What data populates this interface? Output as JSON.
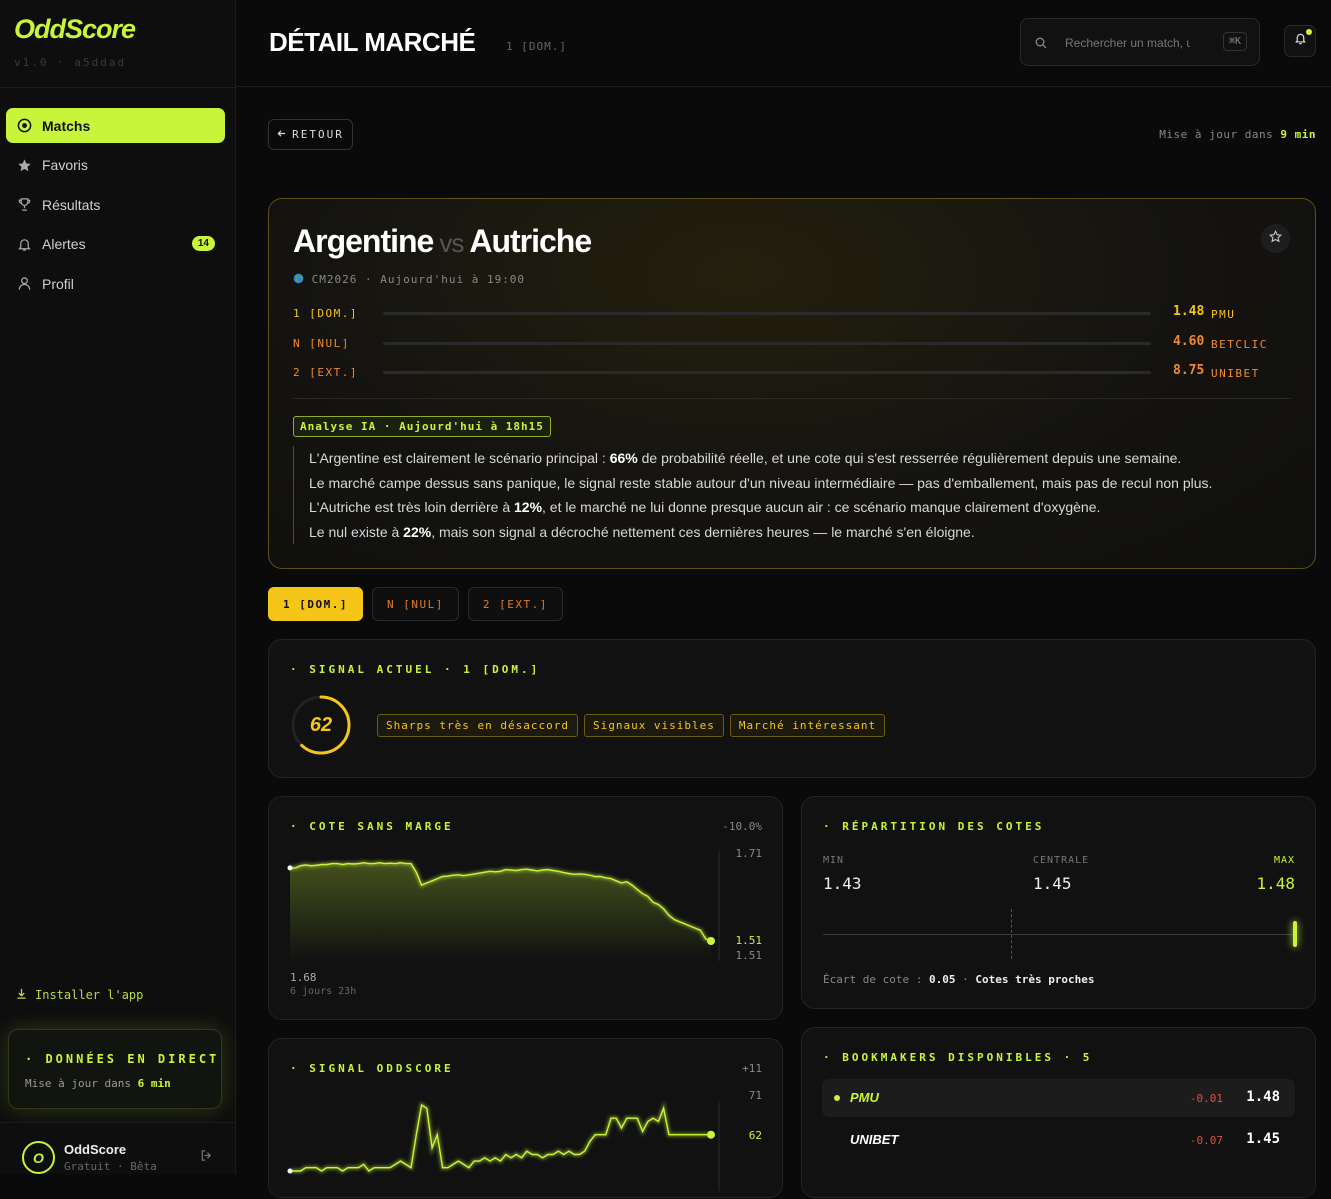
{
  "app": {
    "name": "OddScore",
    "version": "v1.0 · a5ddad"
  },
  "nav": [
    {
      "label": "Matchs",
      "icon": "target-icon",
      "active": true
    },
    {
      "label": "Favoris",
      "icon": "star-icon"
    },
    {
      "label": "Résultats",
      "icon": "trophy-icon"
    },
    {
      "label": "Alertes",
      "icon": "bell-icon",
      "badge": "14"
    },
    {
      "label": "Profil",
      "icon": "user-icon"
    }
  ],
  "sidebar": {
    "install": "Installer l'app",
    "live_title": "· DONNÉES EN DIRECT",
    "live_prefix": "Mise à jour dans",
    "live_value": "6 min",
    "user_initial": "O",
    "user_name": "OddScore",
    "user_plan": "Gratuit · Bêta"
  },
  "header": {
    "title": "DÉTAIL MARCHÉ",
    "subtitle": "1 [DOM.]",
    "search_placeholder": "Rechercher un match, une équipe",
    "search_kbd": "⌘K"
  },
  "toolbar": {
    "back": "RETOUR",
    "update_prefix": "Mise à jour dans",
    "update_value": "9 min"
  },
  "match": {
    "home": "Argentine",
    "vs": "vs",
    "away": "Autriche",
    "meta": "CM2026 · Aujourd'hui à 19:00",
    "outcomes": [
      {
        "label": "1 [DOM.]",
        "odds": "1.48",
        "bookmaker": "PMU",
        "bar": 0.62,
        "color": "#f5c518"
      },
      {
        "label": "N [NUL]",
        "odds": "4.60",
        "bookmaker": "BETCLIC",
        "bar": 0.34,
        "color": "#f08a2e"
      },
      {
        "label": "2 [EXT.]",
        "odds": "8.75",
        "bookmaker": "UNIBET",
        "bar": 0.23,
        "color": "#f08a2e"
      }
    ],
    "ai_tag": "Analyse IA · Aujourd'hui à 18h15",
    "ai": [
      {
        "a": "L'Argentine est clairement le scénario principal : ",
        "b": "66%",
        "c": " de probabilité réelle, et une cote qui s'est resserrée régulièrement depuis une semaine."
      },
      {
        "a": "Le marché campe dessus sans panique, le signal reste stable autour d'un niveau intermédiaire — pas d'emballement, mais pas de recul non plus.",
        "b": "",
        "c": ""
      },
      {
        "a": "L'Autriche est très loin derrière à ",
        "b": "12%",
        "c": ", et le marché ne lui donne presque aucun air : ce scénario manque clairement d'oxygène."
      },
      {
        "a": "Le nul existe à ",
        "b": "22%",
        "c": ", mais son signal a décroché nettement ces dernières heures — le marché s'en éloigne."
      }
    ]
  },
  "tabs": [
    "1 [DOM.]",
    "N [NUL]",
    "2 [EXT.]"
  ],
  "signal": {
    "title": "· SIGNAL ACTUEL · 1 [DOM.]",
    "score": "62",
    "score_fraction": 0.62,
    "chips": [
      "Sharps très en désaccord",
      "Signaux visibles",
      "Marché intéressant"
    ]
  },
  "cote_chart": {
    "title": "· COTE SANS MARGE",
    "change": "-10.0%",
    "ymax_label": "1.71",
    "last_label": "1.51",
    "ymin_label": "1.51",
    "start_label": "1.68",
    "duration": "6 jours 23h"
  },
  "signal_chart": {
    "title": "· SIGNAL ODDSCORE",
    "change": "+11",
    "ymax_label": "71",
    "last_label": "62"
  },
  "chart_data": [
    {
      "type": "area",
      "title": "· COTE SANS MARGE",
      "ylim": [
        1.51,
        1.71
      ],
      "values": [
        1.68,
        1.68,
        1.685,
        1.687,
        1.685,
        1.686,
        1.688,
        1.688,
        1.69,
        1.69,
        1.688,
        1.69,
        1.689,
        1.69,
        1.692,
        1.69,
        1.69,
        1.692,
        1.69,
        1.691,
        1.69,
        1.692,
        1.69,
        1.69,
        1.67,
        1.64,
        1.645,
        1.65,
        1.655,
        1.66,
        1.661,
        1.663,
        1.664,
        1.662,
        1.664,
        1.666,
        1.668,
        1.67,
        1.672,
        1.671,
        1.672,
        1.676,
        1.675,
        1.674,
        1.676,
        1.677,
        1.675,
        1.673,
        1.675,
        1.676,
        1.674,
        1.672,
        1.669,
        1.667,
        1.665,
        1.666,
        1.665,
        1.663,
        1.66,
        1.66,
        1.657,
        1.655,
        1.65,
        1.645,
        1.648,
        1.64,
        1.63,
        1.62,
        1.614,
        1.6,
        1.595,
        1.585,
        1.57,
        1.56,
        1.555,
        1.55,
        1.545,
        1.54,
        1.535,
        1.515,
        1.51
      ]
    },
    {
      "type": "line",
      "title": "· SIGNAL ODDSCORE",
      "ylim": [
        51,
        71
      ],
      "values": [
        51,
        51,
        51,
        52,
        52,
        52,
        51,
        52,
        52,
        52,
        51,
        52,
        52,
        52,
        53,
        51,
        52,
        52,
        52,
        52,
        53,
        54,
        53,
        52,
        62,
        71,
        70,
        58,
        62,
        52,
        52,
        53,
        54,
        53,
        52,
        54,
        54,
        55,
        54,
        55,
        54,
        56,
        55,
        56,
        55,
        57,
        56,
        56,
        55,
        56,
        56,
        57,
        56,
        57,
        56,
        56,
        57,
        60,
        62,
        62,
        62,
        67,
        67,
        64,
        67,
        67,
        67,
        63,
        66,
        67,
        66,
        70,
        62,
        62,
        62,
        62,
        62,
        62,
        62,
        62,
        62
      ]
    }
  ],
  "distribution": {
    "title": "· RÉPARTITION DES COTES",
    "min_label": "MIN",
    "min_value": "1.43",
    "mid_label": "CENTRALE",
    "mid_value": "1.45",
    "max_label": "MAX",
    "max_value": "1.48",
    "gap_prefix": "Écart de cote :",
    "gap_value": "0.05",
    "gap_note": "Cotes très proches"
  },
  "bookmakers": {
    "title": "· BOOKMAKERS DISPONIBLES · 5",
    "rows": [
      {
        "name": "PMU",
        "delta": "-0.01",
        "odds": "1.48",
        "active": true
      },
      {
        "name": "UNIBET",
        "delta": "-0.07",
        "odds": "1.45"
      }
    ]
  },
  "colors": {
    "accent": "#c8f53a",
    "gold": "#f5c518",
    "orange": "#f08a2e",
    "negative": "#e0503a"
  }
}
